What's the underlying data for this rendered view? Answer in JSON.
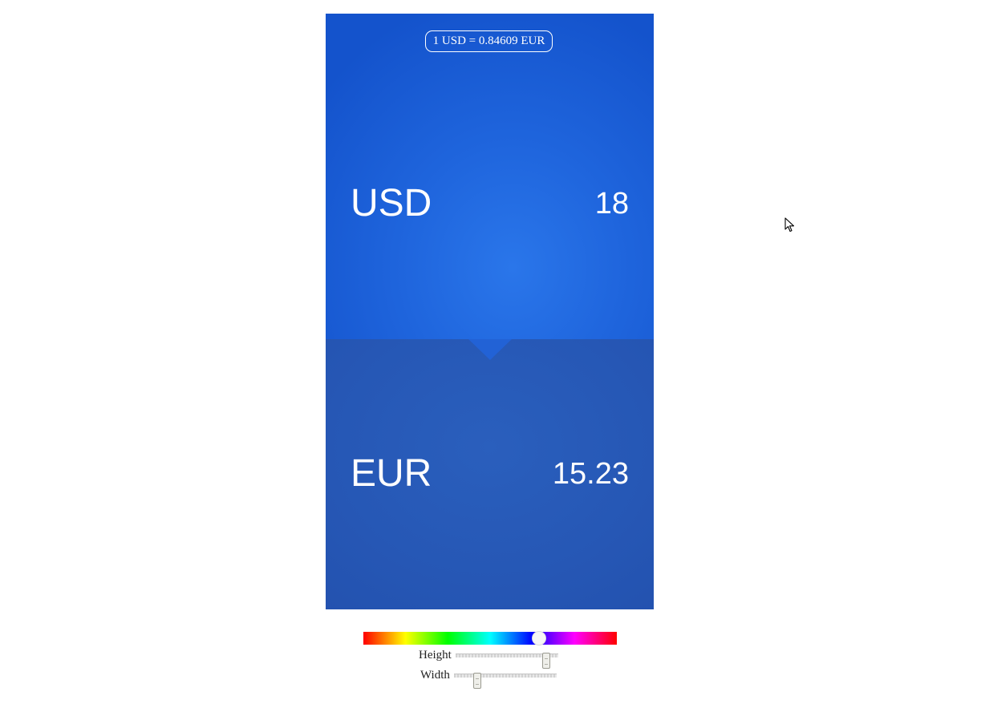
{
  "converter": {
    "rate_text": "1 USD = 0.84609 EUR",
    "from": {
      "code": "USD",
      "amount": "18"
    },
    "to": {
      "code": "EUR",
      "amount": "15.23"
    }
  },
  "controls": {
    "hue": {
      "value_fraction": 0.694
    },
    "height": {
      "label": "Height",
      "value_fraction": 0.88
    },
    "width": {
      "label": "Width",
      "value_fraction": 0.23
    }
  },
  "colors": {
    "top_panel": "#1f65dd",
    "bottom_panel": "#2657b5",
    "text": "#ffffff"
  },
  "icons": {
    "cursor": "mouse-pointer-icon"
  }
}
